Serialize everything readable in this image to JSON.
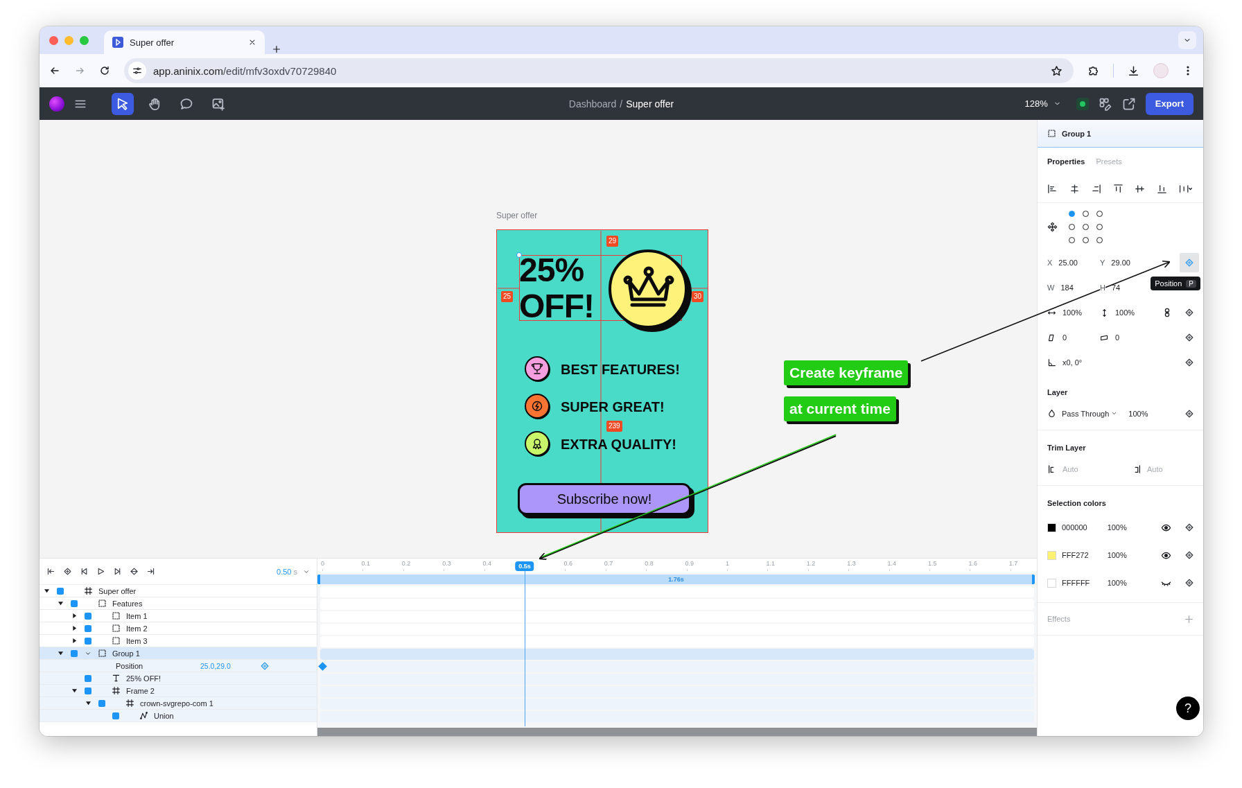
{
  "browser": {
    "tab_title": "Super offer",
    "url_host": "app.aninix.com",
    "url_path": "/edit/mfv3oxdv70729840"
  },
  "app_bar": {
    "tools": [
      {
        "kind": "select",
        "selected": true
      },
      {
        "kind": "hand",
        "selected": false
      },
      {
        "kind": "comment",
        "selected": false
      },
      {
        "kind": "image",
        "selected": false
      }
    ],
    "breadcrumb": {
      "parent": "Dashboard",
      "separator": "/",
      "current": "Super offer"
    },
    "zoom": "128%",
    "export": "Export"
  },
  "canvas": {
    "frame_label": "Super offer",
    "headline": [
      "25%",
      "OFF!"
    ],
    "features": [
      {
        "text": "BEST FEATURES!",
        "color": "#f59ee0",
        "kind": "trophy"
      },
      {
        "text": "SUPER GREAT!",
        "color": "#f97432",
        "kind": "bolt"
      },
      {
        "text": "EXTRA QUALITY!",
        "color": "#c9f56a",
        "kind": "medal"
      }
    ],
    "cta": "Subscribe now!",
    "measurements": [
      {
        "kind": "top",
        "label": "29"
      },
      {
        "kind": "left",
        "label": "25"
      },
      {
        "kind": "right",
        "label": "30"
      },
      {
        "kind": "bottom",
        "label": "239"
      }
    ]
  },
  "annotations": [
    "Create keyframe",
    "at current time"
  ],
  "timeline": {
    "time": "0.50",
    "unit": "s",
    "ticks": [
      "0",
      "0.1",
      "0.2",
      "0.3",
      "0.4",
      "0.6",
      "0.7",
      "0.8",
      "0.9",
      "1",
      "1.1",
      "1.2",
      "1.3",
      "1.4",
      "1.5",
      "1.6",
      "1.7"
    ],
    "playhead": {
      "label": "0.5s",
      "level": 0.284
    },
    "duration": "1.76s",
    "layers": [
      {
        "name": "Super offer",
        "kind": "frame",
        "expanded": true,
        "selected": false,
        "children": [
          {
            "name": "Features",
            "kind": "group",
            "expanded": true,
            "selected": false,
            "children": [
              {
                "name": "Item 1",
                "kind": "group",
                "expanded": false,
                "selected": false
              },
              {
                "name": "Item 2",
                "kind": "group",
                "expanded": false,
                "selected": false
              },
              {
                "name": "Item 3",
                "kind": "group",
                "expanded": false,
                "selected": false
              }
            ]
          },
          {
            "name": "Group 1",
            "kind": "group",
            "expanded": true,
            "selected": true,
            "properties": [
              {
                "name": "Position",
                "value": "25.0,29.0",
                "keyframe": true
              }
            ],
            "children": [
              {
                "name": "25% OFF!",
                "kind": "text",
                "selected": false
              },
              {
                "name": "Frame 2",
                "kind": "frame",
                "expanded": true,
                "selected": false,
                "children": [
                  {
                    "name": "crown-svgrepo-com 1",
                    "kind": "frame",
                    "expanded": true,
                    "selected": false,
                    "children": [
                      {
                        "name": "Union",
                        "kind": "vector",
                        "selected": false
                      }
                    ]
                  }
                ]
              }
            ]
          }
        ]
      }
    ]
  },
  "panel": {
    "title": "Group 1",
    "tabs": [
      {
        "label": "Properties",
        "selected": true
      },
      {
        "label": "Presets",
        "selected": false
      }
    ],
    "anchor": [
      {
        "selected": true
      },
      {
        "selected": false
      },
      {
        "selected": false
      },
      {
        "selected": false
      },
      {
        "selected": false
      },
      {
        "selected": false
      },
      {
        "selected": false
      },
      {
        "selected": false
      },
      {
        "selected": false
      }
    ],
    "transform": [
      {
        "kind": "position",
        "fields": [
          {
            "label": "X",
            "value": "25.00"
          },
          {
            "label": "Y",
            "value": "29.00"
          }
        ]
      },
      {
        "kind": "size",
        "fields": [
          {
            "label": "W",
            "value": "184"
          },
          {
            "label": "H",
            "value": "74"
          }
        ]
      },
      {
        "kind": "scale",
        "fields": [
          {
            "value": "100%"
          },
          {
            "value": "100%"
          }
        ]
      },
      {
        "kind": "skew",
        "fields": [
          {
            "value": "0"
          },
          {
            "value": "0"
          }
        ]
      },
      {
        "kind": "angle",
        "fields": [
          {
            "value": "x0, 0°"
          }
        ]
      }
    ],
    "tooltip": {
      "label": "Position",
      "shortcut": "P"
    },
    "layer": {
      "heading": "Layer",
      "blend": "Pass Through",
      "opacity": "100%"
    },
    "trim": {
      "heading": "Trim Layer",
      "start_placeholder": "Auto",
      "end_placeholder": "Auto"
    },
    "selection_colors": {
      "heading": "Selection colors",
      "items": [
        {
          "hex": "000000",
          "color": "#000000",
          "opacity": "100%",
          "visible": true
        },
        {
          "hex": "FFF272",
          "color": "#fff272",
          "opacity": "100%",
          "visible": true
        },
        {
          "hex": "FFFFFF",
          "color": "#ffffff",
          "opacity": "100%",
          "visible": false
        }
      ]
    },
    "effects": "Effects",
    "help": "?"
  }
}
